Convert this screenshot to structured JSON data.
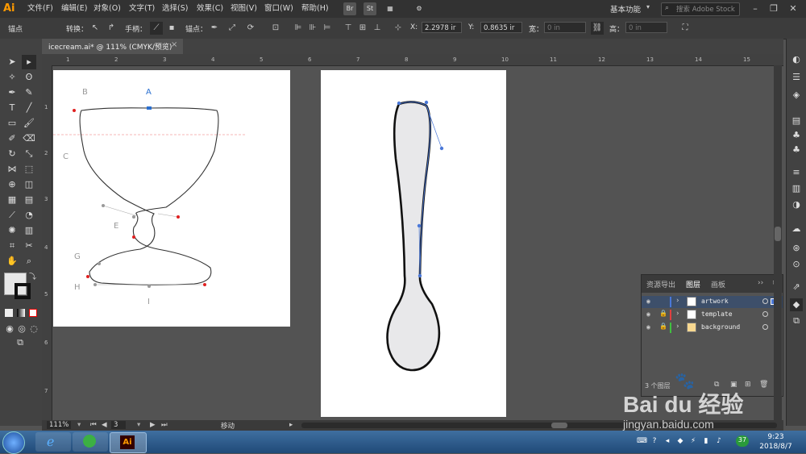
{
  "app": {
    "logo": "Ai",
    "workspace": "基本功能",
    "search_placeholder": "搜索 Adobe Stock"
  },
  "menu": [
    "文件(F)",
    "编辑(E)",
    "对象(O)",
    "文字(T)",
    "选择(S)",
    "效果(C)",
    "视图(V)",
    "窗口(W)",
    "帮助(H)"
  ],
  "menubar_icons": {
    "bridge": "Br",
    "stock": "St"
  },
  "control": {
    "anchor_label": "锚点",
    "convert_label": "转换：",
    "handle_label": "手柄：",
    "anchor2_label": "锚点：",
    "x_label": "X:",
    "x_value": "2.2978",
    "x_unit": "ir",
    "y_label": "Y:",
    "y_value": "0.8635",
    "y_unit": "ir",
    "w_label": "宽：",
    "w_value": "0 in",
    "h_label": "高：",
    "h_value": "0 in"
  },
  "document": {
    "tab_title": "icecream.ai* @ 111% (CMYK/预览)",
    "close": "×"
  },
  "ruler": {
    "top": [
      "1",
      "2",
      "3",
      "4",
      "5",
      "6",
      "7",
      "8",
      "9",
      "10",
      "11",
      "12",
      "13",
      "14",
      "15"
    ],
    "left": [
      "1",
      "2",
      "3",
      "4",
      "5",
      "6",
      "7"
    ]
  },
  "artboard_labels": {
    "a": "A",
    "b": "B",
    "c": "C",
    "e": "E",
    "g": "G",
    "h": "H",
    "i": "I"
  },
  "layers_panel": {
    "tabs": [
      "资源导出",
      "图层",
      "画板"
    ],
    "active_tab": "图层",
    "rows": [
      {
        "name": "artwork",
        "color": "#4a78d8",
        "locked": false,
        "selected": true
      },
      {
        "name": "template",
        "color": "#e04040",
        "locked": true,
        "selected": false
      },
      {
        "name": "background",
        "color": "#40c040",
        "locked": true,
        "selected": false
      }
    ],
    "footer": "3 个图层"
  },
  "status": {
    "zoom": "111%",
    "page": "3",
    "tool": "移动"
  },
  "taskbar": {
    "time": "9:23",
    "date": "2018/8/7",
    "badge": "37",
    "ai_label": "Ai"
  },
  "watermark": {
    "brand": "Bai du 经验",
    "url": "jingyan.baidu.com"
  },
  "colors": {
    "accent": "#ff9a00",
    "selection_blue": "#4a78d8",
    "anchor_red": "#e02020"
  }
}
